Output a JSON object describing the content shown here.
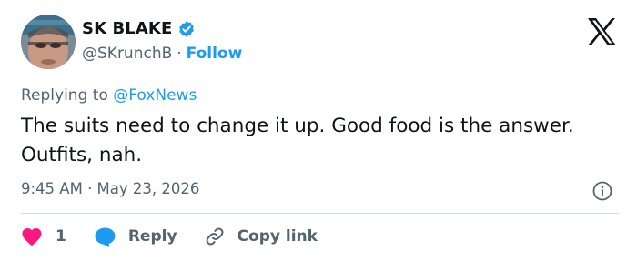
{
  "tweet": {
    "author": {
      "display_name": "SK BLAKE",
      "handle": "@SKrunchB",
      "verified": true
    },
    "follow_label": "Follow",
    "separator": "·",
    "replying_to_prefix": "Replying to",
    "replying_to_handle": "@FoxNews",
    "text": "The suits need to change it up. Good food is the answer. Outfits, nah.",
    "timestamp": "9:45 AM · May 23, 2026",
    "like_count": "1",
    "reply_label": "Reply",
    "copy_link_label": "Copy link"
  },
  "colors": {
    "accent": "#1d9bf0",
    "like": "#f91880",
    "secondary_text": "#536471",
    "primary_text": "#0f1419"
  },
  "icons": {
    "verified": "verified-badge-icon",
    "brand": "x-logo-icon",
    "info": "info-icon",
    "like": "heart-icon",
    "reply": "speech-bubble-icon",
    "copy": "link-icon"
  }
}
